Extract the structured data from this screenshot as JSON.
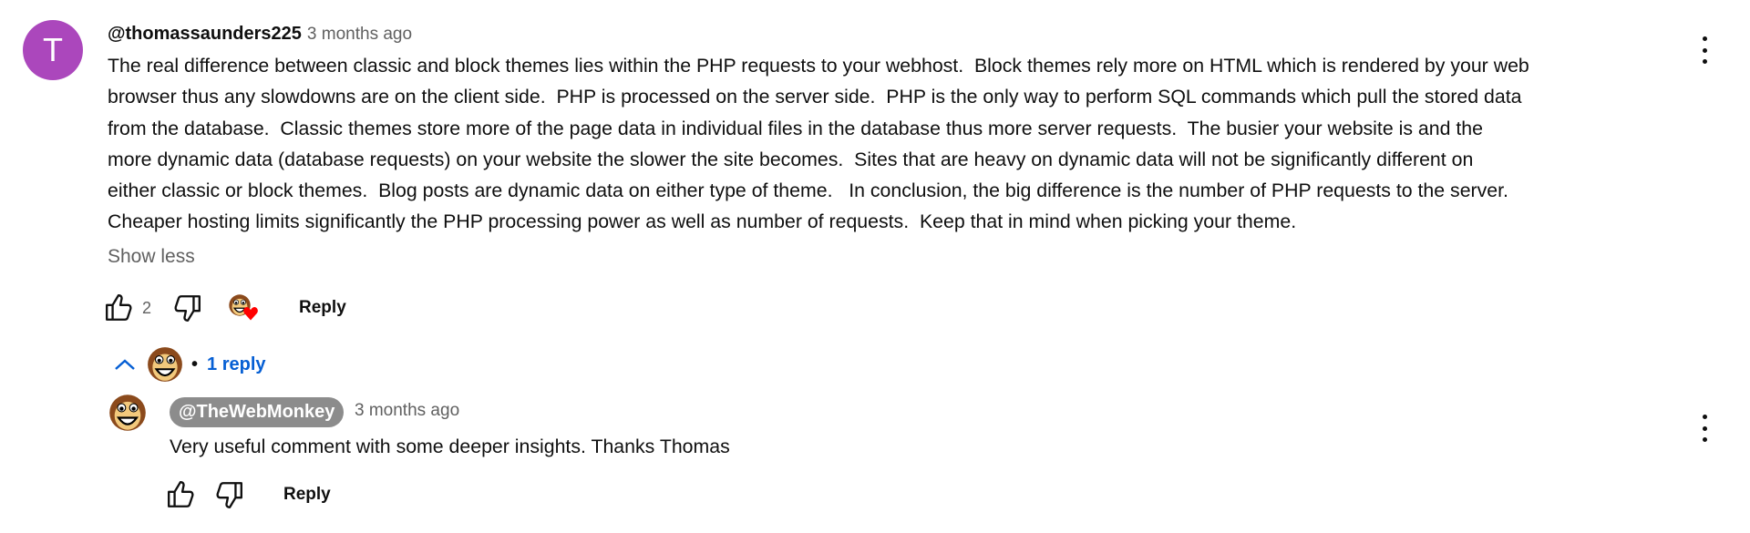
{
  "comment": {
    "avatar_letter": "T",
    "avatar_color": "#ab47bc",
    "author": "@thomassaunders225",
    "timestamp": "3 months ago",
    "body_lines": [
      "The real difference between classic and block themes lies within the PHP requests to your webhost.  Block themes rely more on HTML which is rendered by your web",
      "browser thus any slowdowns are on the client side.  PHP is processed on the server side.  PHP is the only way to perform SQL commands which pull the stored data",
      "from the database.  Classic themes store more of the page data in individual files in the database thus more server requests.  The busier your website is and the",
      "more dynamic data (database requests) on your website the slower the site becomes.  Sites that are heavy on dynamic data will not be significantly different on",
      "either classic or block themes.  Blog posts are dynamic data on either type of theme.   In conclusion, the big difference is the number of PHP requests to the server.",
      "Cheaper hosting limits significantly the PHP processing power as well as number of requests.  Keep that in mind when picking your theme."
    ],
    "show_less_label": "Show less",
    "like_count": "2",
    "creator_heart": true,
    "reply_label": "Reply",
    "replies_toggle_label": "1 reply",
    "replies_bullet": "•"
  },
  "reply": {
    "author": "@TheWebMonkey",
    "timestamp": "3 months ago",
    "text": "Very useful comment with some deeper insights. Thanks Thomas",
    "reply_label": "Reply"
  },
  "colors": {
    "link": "#065fd4",
    "heart": "#ff0000",
    "secondary_text": "#606060"
  }
}
